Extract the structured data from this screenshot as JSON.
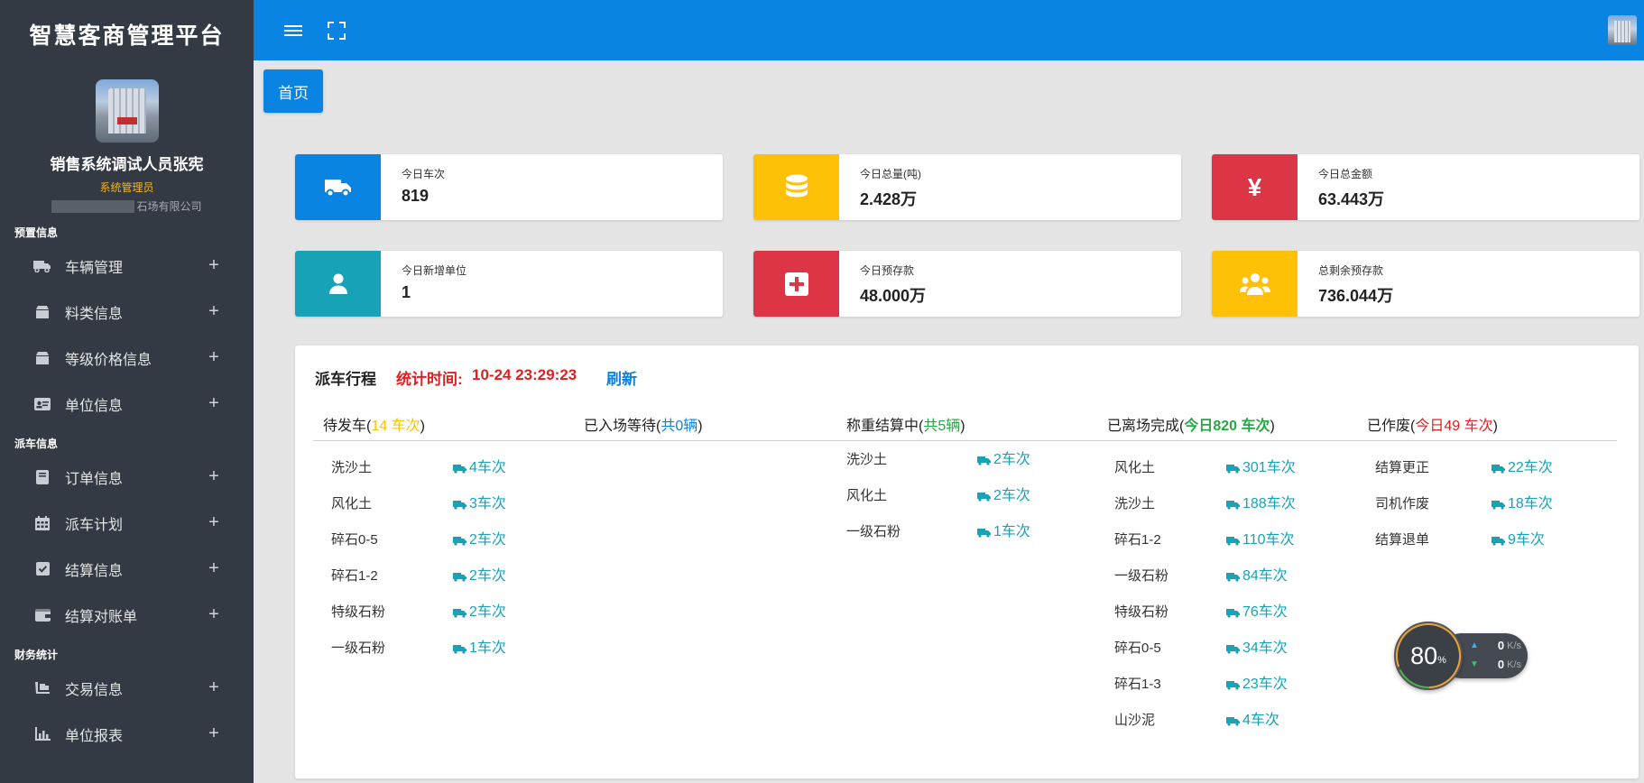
{
  "app": {
    "title": "智慧客商管理平台"
  },
  "user": {
    "name": "销售系统调试人员张宪",
    "role": "系统管理员",
    "company_suffix": "石场有限公司"
  },
  "sidebar": {
    "sections": [
      {
        "title": "预置信息",
        "items": [
          {
            "label": "车辆管理",
            "icon": "truck-icon"
          },
          {
            "label": "料类信息",
            "icon": "box-icon"
          },
          {
            "label": "等级价格信息",
            "icon": "box-icon"
          },
          {
            "label": "单位信息",
            "icon": "id-card-icon"
          }
        ]
      },
      {
        "title": "派车信息",
        "items": [
          {
            "label": "订单信息",
            "icon": "book-icon"
          },
          {
            "label": "派车计划",
            "icon": "calendar-icon"
          },
          {
            "label": "结算信息",
            "icon": "check-square-icon"
          },
          {
            "label": "结算对账单",
            "icon": "wallet-icon"
          }
        ]
      },
      {
        "title": "财务统计",
        "items": [
          {
            "label": "交易信息",
            "icon": "dolly-icon"
          },
          {
            "label": "单位报表",
            "icon": "bar-chart-icon"
          }
        ]
      }
    ],
    "expand_symbol": "+"
  },
  "tabs": {
    "home": "首页"
  },
  "stats": [
    {
      "label": "今日车次",
      "value": "819",
      "color": "#0a84e3",
      "icon": "truck-icon"
    },
    {
      "label": "今日总量(吨)",
      "value": "2.428万",
      "color": "#ffc107",
      "icon": "database-icon"
    },
    {
      "label": "今日总金额",
      "value": "63.443万",
      "color": "#dc3545",
      "icon": "yen-icon"
    },
    {
      "label": "今日新增单位",
      "value": "1",
      "color": "#17a2b8",
      "icon": "user-icon"
    },
    {
      "label": "今日预存款",
      "value": "48.000万",
      "color": "#dc3545",
      "icon": "plus-square-icon"
    },
    {
      "label": "总剩余预存款",
      "value": "736.044万",
      "color": "#ffc107",
      "icon": "users-icon"
    }
  ],
  "dispatch": {
    "title": "派车行程",
    "time_label": "统计时间:",
    "time_value": "10-24 23:29:23",
    "refresh": "刷新",
    "columns": [
      {
        "name": "待发车",
        "open": "(",
        "count": "14 车次",
        "close": ")",
        "rows": [
          {
            "material": "洗沙土",
            "count": "4车次"
          },
          {
            "material": "风化土",
            "count": "3车次"
          },
          {
            "material": "碎石0-5",
            "count": "2车次"
          },
          {
            "material": "碎石1-2",
            "count": "2车次"
          },
          {
            "material": "特级石粉",
            "count": "2车次"
          },
          {
            "material": "一级石粉",
            "count": "1车次"
          }
        ]
      },
      {
        "name": "已入场等待",
        "open": "(",
        "count": "共0辆",
        "close": ")",
        "rows": []
      },
      {
        "name": "称重结算中",
        "open": "(",
        "count": "共5辆",
        "close": ")",
        "rows": [
          {
            "material": "洗沙土",
            "count": "2车次"
          },
          {
            "material": "风化土",
            "count": "2车次"
          },
          {
            "material": "一级石粉",
            "count": "1车次"
          }
        ]
      },
      {
        "name": "已离场完成",
        "open": "(",
        "count": "今日820 车次",
        "close": ")",
        "rows": [
          {
            "material": "风化土",
            "count": "301车次"
          },
          {
            "material": "洗沙土",
            "count": "188车次"
          },
          {
            "material": "碎石1-2",
            "count": "110车次"
          },
          {
            "material": "一级石粉",
            "count": "84车次"
          },
          {
            "material": "特级石粉",
            "count": "76车次"
          },
          {
            "material": "碎石0-5",
            "count": "34车次"
          },
          {
            "material": "碎石1-3",
            "count": "23车次"
          },
          {
            "material": "山沙泥",
            "count": "4车次"
          }
        ]
      },
      {
        "name": "已作废",
        "open": "(",
        "count": "今日49 车次",
        "close": ")",
        "rows": [
          {
            "material": "结算更正",
            "count": "22车次"
          },
          {
            "material": "司机作废",
            "count": "18车次"
          },
          {
            "material": "结算退单",
            "count": "9车次"
          }
        ]
      }
    ]
  },
  "speed_widget": {
    "percent": "80",
    "percent_unit": "%",
    "up": "0",
    "down": "0",
    "unit": "K/s"
  }
}
